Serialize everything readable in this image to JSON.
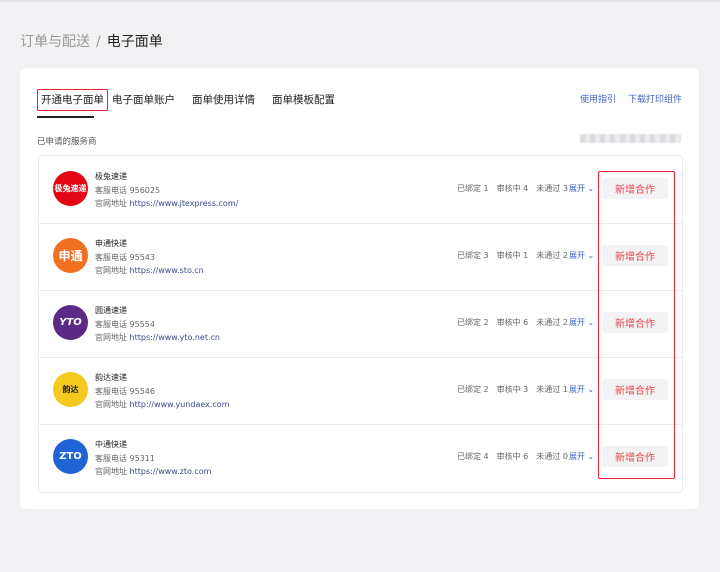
{
  "breadcrumb": {
    "parent": "订单与配送",
    "separator": "/",
    "current": "电子面单"
  },
  "tabs": [
    {
      "label": "开通电子面单",
      "active": true
    },
    {
      "label": "电子面单账户",
      "active": false
    },
    {
      "label": "面单使用详情",
      "active": false
    },
    {
      "label": "面单模板配置",
      "active": false
    }
  ],
  "links": {
    "guide": "使用指引",
    "download": "下载打印组件"
  },
  "section_label": "已申请的服务商",
  "providers": [
    {
      "name": "极兔速递",
      "logo_text": "极兔速递",
      "logo_color": "#e30613",
      "phone": "客服电话 956025",
      "site": "官网地址",
      "url": "https://www.jtexpress.com/",
      "bound": "已绑定 1",
      "reviewing": "审核中 4",
      "rejected": "未通过 3",
      "expand": "展开",
      "action": "新增合作"
    },
    {
      "name": "申通快递",
      "logo_text": "申通",
      "logo_color": "#f07020",
      "phone": "客服电话 95543",
      "site": "官网地址",
      "url": "https://www.sto.cn",
      "bound": "已绑定 3",
      "reviewing": "审核中 1",
      "rejected": "未通过 2",
      "expand": "展开",
      "action": "新增合作"
    },
    {
      "name": "圆通速递",
      "logo_text": "YTO",
      "logo_color": "#5b2a86",
      "phone": "客服电话 95554",
      "site": "官网地址",
      "url": "https://www.yto.net.cn",
      "bound": "已绑定 2",
      "reviewing": "审核中 6",
      "rejected": "未通过 2",
      "expand": "展开",
      "action": "新增合作"
    },
    {
      "name": "韵达速递",
      "logo_text": "韵达",
      "logo_color": "#f5c91e",
      "phone": "客服电话 95546",
      "site": "官网地址",
      "url": "http://www.yundaex.com",
      "bound": "已绑定 2",
      "reviewing": "审核中 3",
      "rejected": "未通过 1",
      "expand": "展开",
      "action": "新增合作"
    },
    {
      "name": "中通快递",
      "logo_text": "ZTO",
      "logo_color": "#1f63d6",
      "phone": "客服电话 95311",
      "site": "官网地址",
      "url": "https://www.zto.com",
      "bound": "已绑定 4",
      "reviewing": "审核中 6",
      "rejected": "未通过 0",
      "expand": "展开",
      "action": "新增合作"
    }
  ],
  "colors": {
    "accent": "#e84545",
    "link": "#3f63c2",
    "highlight": "#e22233"
  }
}
